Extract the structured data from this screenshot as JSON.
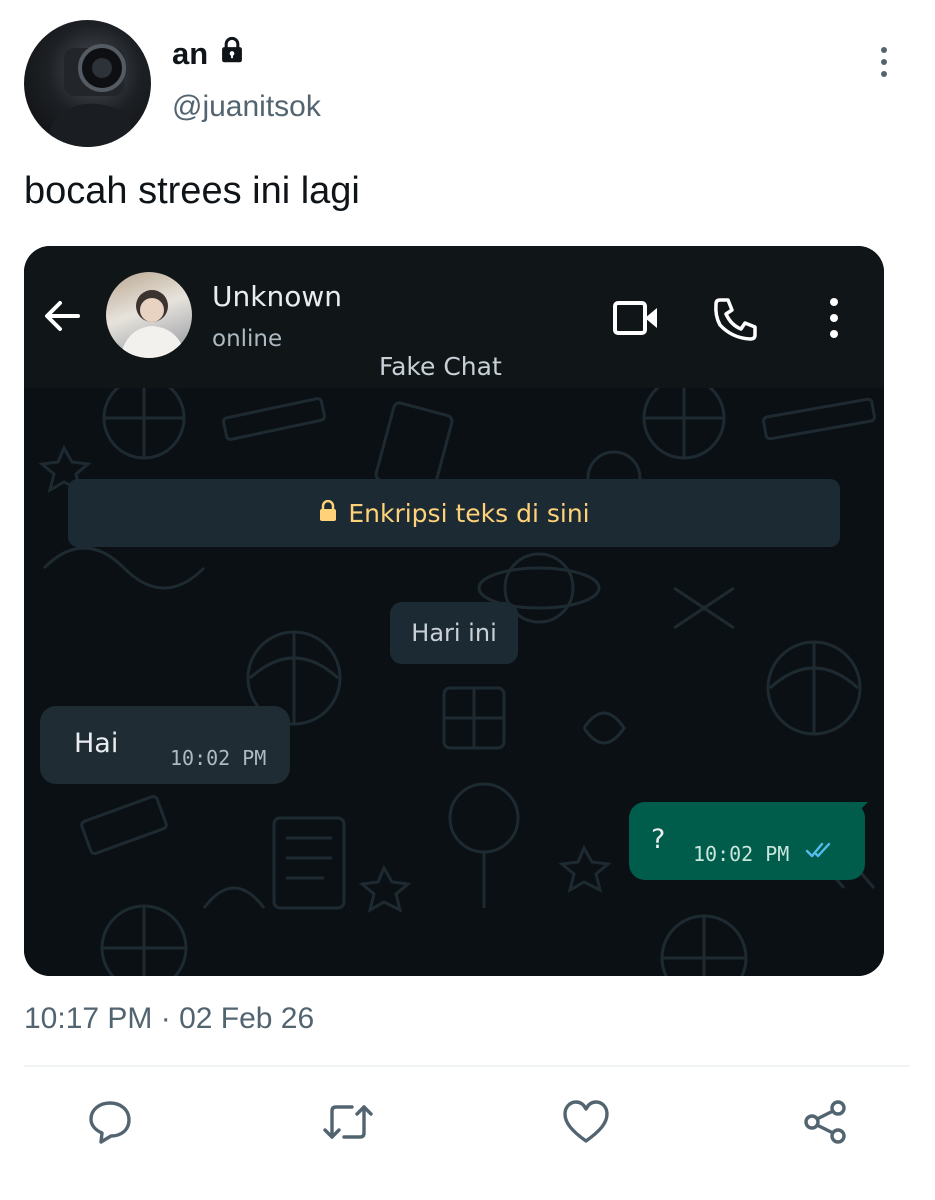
{
  "tweet": {
    "display_name": "an",
    "handle": "@juanitsok",
    "text": "bocah strees ini lagi",
    "timestamp": "10:17 PM · 02 Feb 26",
    "protected_icon": "lock-icon"
  },
  "chat": {
    "contact_name": "Unknown",
    "contact_status": "online",
    "watermark": "Fake Chat",
    "encryption_notice": "Enkripsi teks di sini",
    "day_separator": "Hari ini",
    "messages": [
      {
        "direction": "incoming",
        "text": "Hai",
        "time": "10:02 PM"
      },
      {
        "direction": "outgoing",
        "text": "?",
        "time": "10:02 PM",
        "status": "read"
      }
    ],
    "header_icons": [
      "back-arrow-icon",
      "video-call-icon",
      "phone-icon",
      "kebab-menu-icon"
    ]
  },
  "actions": [
    "reply-icon",
    "retweet-icon",
    "like-icon",
    "share-icon"
  ],
  "colors": {
    "chat_background": "#0b1014",
    "outgoing_bubble": "#005c4b",
    "incoming_bubble": "#1f2c34",
    "encryption_text": "#ffd279",
    "read_ticks": "#53bdeb",
    "secondary_text": "#536471"
  }
}
